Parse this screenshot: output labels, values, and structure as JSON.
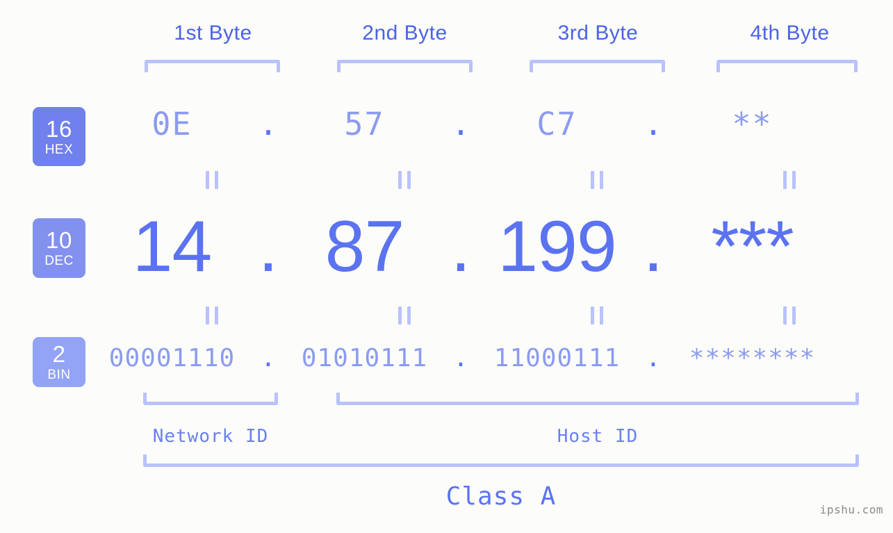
{
  "diagram": {
    "byte_headers": [
      {
        "label": "1st Byte"
      },
      {
        "label": "2nd Byte"
      },
      {
        "label": "3rd Byte"
      },
      {
        "label": "4th Byte"
      }
    ],
    "radix_rows": [
      {
        "base": "16",
        "name": "HEX",
        "color": "#7080ec",
        "values": [
          "0E",
          "57",
          "C7",
          "**"
        ],
        "separator": "."
      },
      {
        "base": "10",
        "name": "DEC",
        "color": "#8391ee",
        "values": [
          "14",
          "87",
          "199",
          "***"
        ],
        "separator": "."
      },
      {
        "base": "2",
        "name": "BIN",
        "color": "#93a3f5",
        "values": [
          "00001110",
          "01010111",
          "11000111",
          "********"
        ],
        "separator": "."
      }
    ],
    "equality_symbol": "=",
    "sections": [
      {
        "label": "Network ID"
      },
      {
        "label": "Host ID"
      }
    ],
    "class_label": "Class A",
    "watermark": "ipshu.com",
    "colors": {
      "background": "#fcfdfa",
      "header_text": "#4a63e8",
      "bracket": "#b9c2fb",
      "value_light": "#8c9bf0",
      "value_strong": "#5b73f0"
    }
  }
}
